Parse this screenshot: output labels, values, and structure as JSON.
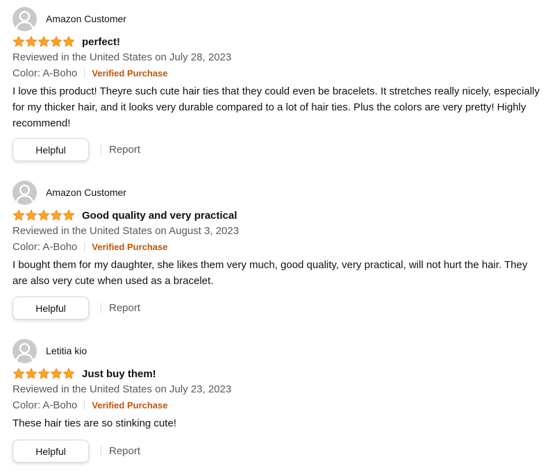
{
  "colors": {
    "star": "#ffa41c",
    "verified": "#c45500",
    "secondary_text": "#565959",
    "primary_text": "#0f1111",
    "avatar_bg": "#c7c9cb"
  },
  "reviews": [
    {
      "author": "Amazon Customer",
      "rating": 5,
      "title": "perfect!",
      "date": "Reviewed in the United States on July 28, 2023",
      "color": "Color: A-Boho",
      "verified": "Verified Purchase",
      "body": "I love this product! Theyre such cute hair ties that they could even be bracelets. It stretches really nicely, especially for my thicker hair, and it looks very durable compared to a lot of hair ties. Plus the colors are very pretty! Highly recommend!",
      "helpful_label": "Helpful",
      "report_label": "Report"
    },
    {
      "author": "Amazon Customer",
      "rating": 5,
      "title": "Good quality and very practical",
      "date": "Reviewed in the United States on August 3, 2023",
      "color": "Color: A-Boho",
      "verified": "Verified Purchase",
      "body": "I bought them for my daughter, she likes them very much, good quality, very practical, will not hurt the hair. They are also very cute when used as a bracelet.",
      "helpful_label": "Helpful",
      "report_label": "Report"
    },
    {
      "author": "Letitia kio",
      "rating": 5,
      "title": "Just buy them!",
      "date": "Reviewed in the United States on July 23, 2023",
      "color": "Color: A-Boho",
      "verified": "Verified Purchase",
      "body": "These hair ties are so stinking cute!",
      "helpful_label": "Helpful",
      "report_label": "Report"
    }
  ]
}
